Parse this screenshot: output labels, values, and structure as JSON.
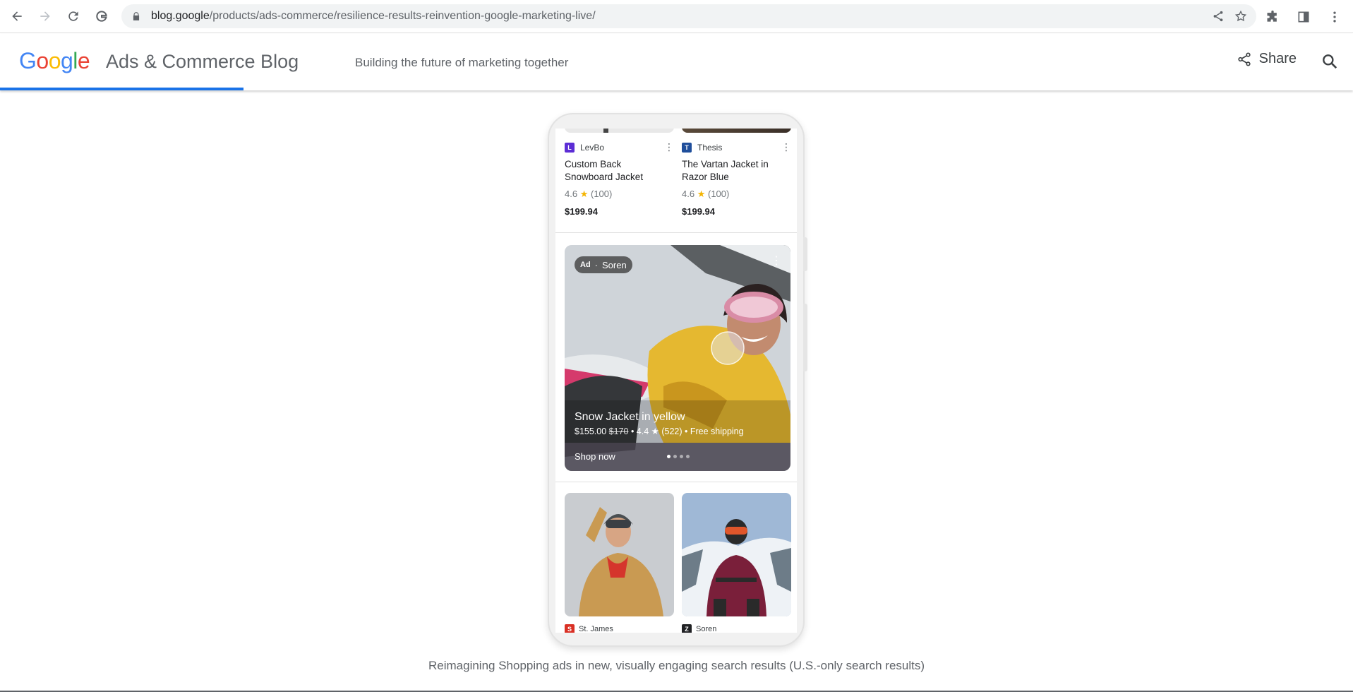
{
  "browser": {
    "url_host": "blog.google",
    "url_path": "/products/ads-commerce/resilience-results-reinvention-google-marketing-live/"
  },
  "header": {
    "logo_letters": [
      "G",
      "o",
      "o",
      "g",
      "l",
      "e"
    ],
    "logo_colors": [
      "#4285F4",
      "#EA4335",
      "#FBBC05",
      "#4285F4",
      "#34A853",
      "#EA4335"
    ],
    "blog_title": "Ads & Commerce Blog",
    "tagline": "Building the future of marketing together",
    "share_label": "Share",
    "accent_color": "#1a73e8",
    "reading_progress": 0.18
  },
  "phone": {
    "products": [
      {
        "merchant": "LevBo",
        "merchant_initial": "L",
        "logo_color": "#5c2dd5",
        "name": "Custom Back Snowboard Jacket",
        "rating": "4.6",
        "star": "★",
        "reviews": "(100)",
        "price": "$199.94"
      },
      {
        "merchant": "Thesis",
        "merchant_initial": "T",
        "logo_color": "#1f4e9b",
        "name": "The Vartan Jacket in Razor Blue",
        "rating": "4.6",
        "star": "★",
        "reviews": "(100)",
        "price": "$199.94"
      }
    ],
    "ad": {
      "badge_ad": "Ad",
      "badge_sep": "·",
      "merchant": "Soren",
      "title": "Snow Jacket in yellow",
      "price": "$155.00",
      "old_price": "$170",
      "meta_rest": " • 4.4 ★ (522) • Free shipping",
      "cta": "Shop now",
      "carousel_total": 4,
      "carousel_active": 1
    },
    "grid_merchants": [
      {
        "name": "St. James",
        "initial": "S",
        "logo_color": "#d93025"
      },
      {
        "name": "Soren",
        "initial": "Z",
        "logo_color": "#202124"
      }
    ]
  },
  "caption": "Reimagining Shopping ads in new, visually engaging search results (U.S.-only search results)"
}
